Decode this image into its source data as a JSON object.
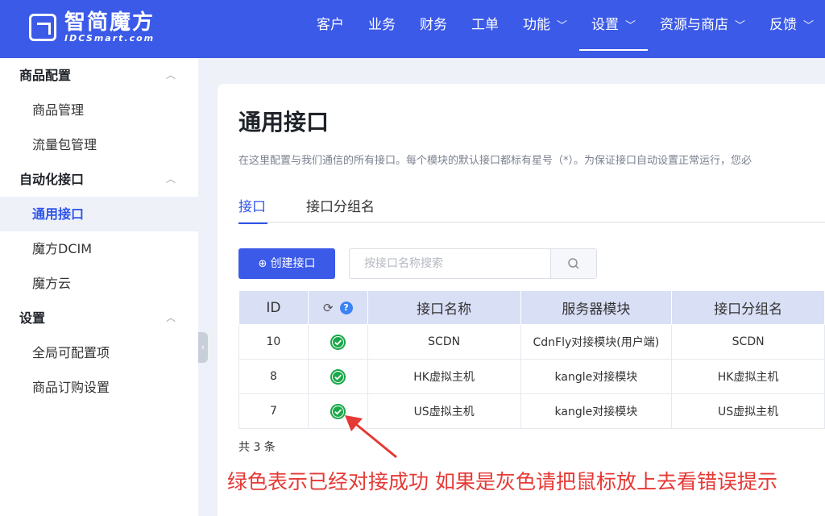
{
  "brand": {
    "name_cn": "智简魔方",
    "name_en": "IDCSmart.com"
  },
  "nav": [
    {
      "label": "客户",
      "caret": false
    },
    {
      "label": "业务",
      "caret": false
    },
    {
      "label": "财务",
      "caret": false
    },
    {
      "label": "工单",
      "caret": false
    },
    {
      "label": "功能",
      "caret": true
    },
    {
      "label": "设置",
      "caret": true,
      "active": true
    },
    {
      "label": "资源与商店",
      "caret": true
    },
    {
      "label": "反馈",
      "caret": true
    }
  ],
  "sidebar": {
    "sections": [
      {
        "label": "商品配置",
        "items": [
          "商品管理",
          "流量包管理"
        ]
      },
      {
        "label": "自动化接口",
        "items": [
          "通用接口",
          "魔方DCIM",
          "魔方云"
        ]
      },
      {
        "label": "设置",
        "items": [
          "全局可配置项",
          "商品订购设置"
        ]
      }
    ],
    "active_item": "通用接口"
  },
  "page": {
    "title": "通用接口",
    "description": "在这里配置与我们通信的所有接口。每个模块的默认接口都标有星号（*）。为保证接口自动设置正常运行，您必",
    "tabs": [
      "接口",
      "接口分组名"
    ],
    "active_tab": "接口"
  },
  "toolbar": {
    "create_label": "创建接口",
    "search_placeholder": "按接口名称搜索"
  },
  "table": {
    "headers": [
      "ID",
      "",
      "接口名称",
      "服务器模块",
      "接口分组名"
    ],
    "rows": [
      {
        "id": "10",
        "status": "ok",
        "name": "SCDN",
        "module": "CdnFly对接模块(用户端)",
        "group": "SCDN"
      },
      {
        "id": "8",
        "status": "ok",
        "name": "HK虚拟主机",
        "module": "kangle对接模块",
        "group": "HK虚拟主机"
      },
      {
        "id": "7",
        "status": "ok",
        "name": "US虚拟主机",
        "module": "kangle对接模块",
        "group": "US虚拟主机"
      }
    ],
    "total": "共 3 条"
  },
  "annotation": "绿色表示已经对接成功 如果是灰色请把鼠标放上去看错误提示",
  "colors": {
    "primary": "#3b5ae8",
    "success": "#19a94a",
    "annotation": "#e53935"
  }
}
